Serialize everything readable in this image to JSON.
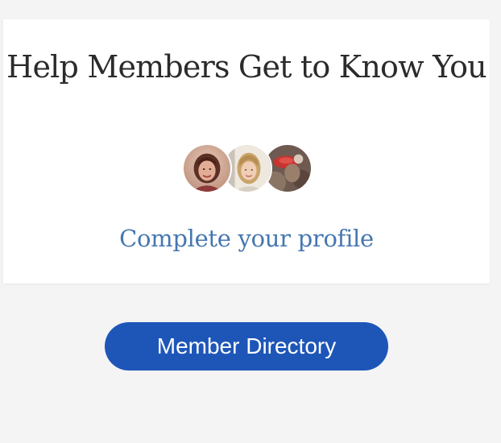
{
  "profile_card": {
    "headline": "Help Members Get to Know You",
    "cta_label": "Complete your profile",
    "avatars": [
      {
        "name": "member-avatar-1"
      },
      {
        "name": "member-avatar-2"
      },
      {
        "name": "member-avatar-3"
      }
    ]
  },
  "directory_button": {
    "label": "Member Directory"
  },
  "colors": {
    "page_background": "#f4f4f5",
    "card_background": "#ffffff",
    "headline_text": "#2b2b2b",
    "link": "#4577b0",
    "button_background": "#1e56b8",
    "button_text": "#ffffff"
  }
}
